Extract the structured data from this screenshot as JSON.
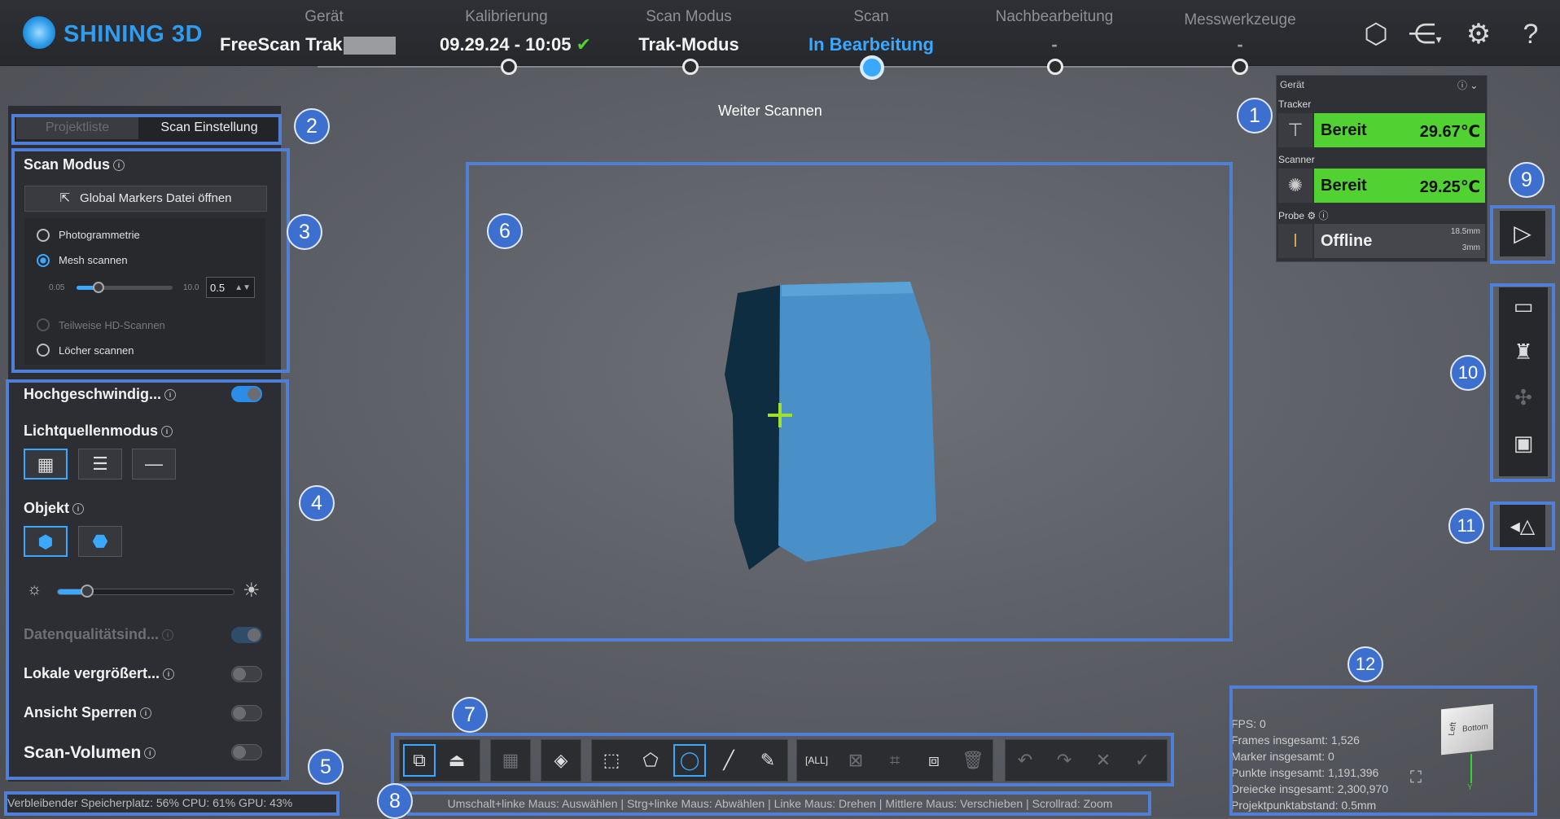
{
  "app": {
    "logo_text": "SHINING 3D"
  },
  "steps": [
    {
      "label": "Gerät",
      "value": "FreeScan Trak"
    },
    {
      "label": "Kalibrierung",
      "value": "09.29.24 - 10:05"
    },
    {
      "label": "Scan Modus",
      "value": "Trak-Modus"
    },
    {
      "label": "Scan",
      "value": "In Bearbeitung"
    },
    {
      "label": "Nachbearbeitung",
      "value": "-"
    },
    {
      "label": "Messwerkzeuge",
      "value": "-"
    }
  ],
  "tabs": {
    "project": "Projektliste",
    "scan_settings": "Scan Einstellung"
  },
  "scan_mode": {
    "title": "Scan Modus",
    "open_markers": "Global Markers Datei öffnen",
    "options": [
      "Photogrammetrie",
      "Mesh scannen",
      "Teilweise HD-Scannen",
      "Löcher scannen"
    ],
    "slider_min": "0.05",
    "slider_max": "10.0",
    "slider_value": "0.5"
  },
  "settings": {
    "high_speed": "Hochgeschwindig...",
    "light_mode": "Lichtquellenmodus",
    "object": "Objekt",
    "data_quality": "Datenqualitätsind...",
    "local_zoom": "Lokale vergrößert...",
    "lock_view": "Ansicht Sperren",
    "scan_volume": "Scan-Volumen"
  },
  "viewport": {
    "hint": "Weiter Scannen"
  },
  "device": {
    "title": "Gerät",
    "tracker_label": "Tracker",
    "tracker_status": "Bereit",
    "tracker_temp": "29.67℃",
    "scanner_label": "Scanner",
    "scanner_status": "Bereit",
    "scanner_temp": "29.25℃",
    "probe_label": "Probe",
    "probe_status": "Offline",
    "probe_len": "18.5mm",
    "probe_dia": "3mm"
  },
  "status": {
    "resources": "Verbleibender Speicherplatz: 56%  CPU: 61%  GPU: 43%",
    "mouse_hints": "Umschalt+linke Maus: Auswählen | Strg+linke Maus: Abwählen | Linke Maus: Drehen | Mittlere Maus: Verschieben | Scrollrad: Zoom"
  },
  "stats": {
    "fps": "FPS: 0",
    "frames": "Frames insgesamt: 1,526",
    "markers": "Marker insgesamt: 0",
    "points": "Punkte insgesamt: 1,191,396",
    "triangles": "Dreiecke insgesamt: 2,300,970",
    "spacing": "Projektpunktabstand: 0.5mm"
  },
  "view_cube": {
    "left": "Left",
    "bottom": "Bottom",
    "axis_y": "Y"
  },
  "callouts": [
    "1",
    "2",
    "3",
    "4",
    "5",
    "6",
    "7",
    "8",
    "9",
    "10",
    "11",
    "12"
  ],
  "colors": {
    "accent": "#3aa8ff",
    "ready": "#52d132",
    "callout": "#3d6fcf",
    "mesh": "#4a90c8"
  }
}
